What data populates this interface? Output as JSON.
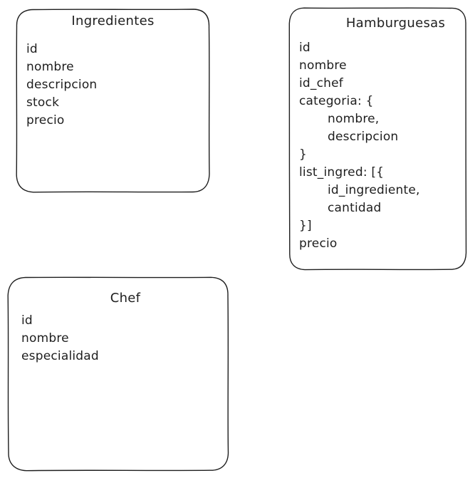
{
  "colors": {
    "stroke": "#1e1e1e",
    "text": "#1e1e1e",
    "background": "#ffffff"
  },
  "entities": {
    "ingredientes": {
      "title": "Ingredientes",
      "fields": [
        "id",
        "nombre",
        "descripcion",
        "stock",
        "precio"
      ]
    },
    "hamburguesas": {
      "title": "Hamburguesas",
      "fields": [
        "id",
        "nombre",
        "id_chef",
        "categoria: {",
        "nombre,",
        "descripcion",
        "}",
        "list_ingred: [{",
        "id_ingrediente,",
        "cantidad",
        "}]",
        "precio"
      ]
    },
    "chef": {
      "title": "Chef",
      "fields": [
        "id",
        "nombre",
        "especialidad"
      ]
    }
  }
}
